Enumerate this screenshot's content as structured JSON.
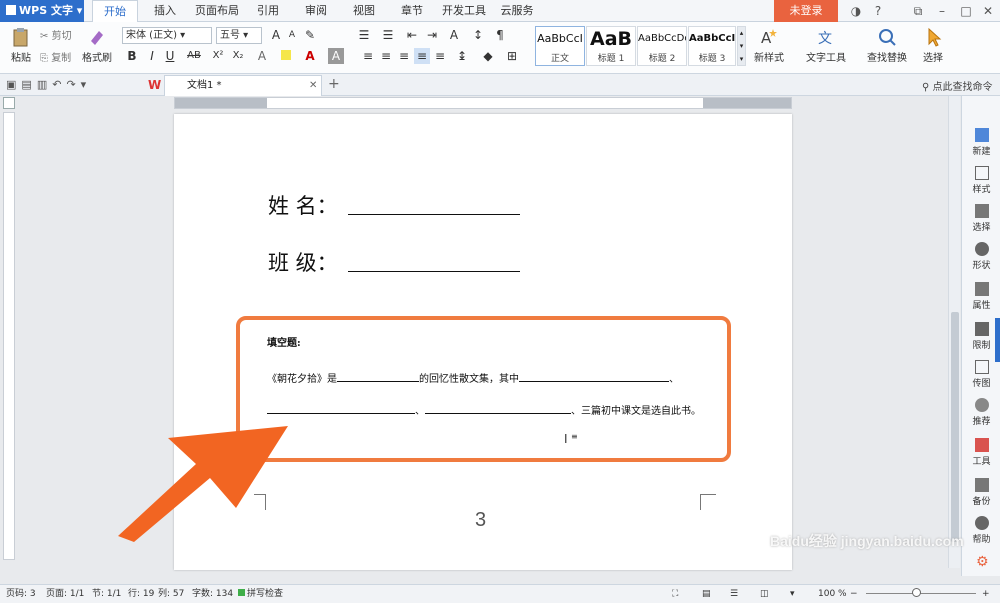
{
  "app": {
    "name": "WPS 文字",
    "login": "未登录"
  },
  "menu_tabs": [
    "开始",
    "插入",
    "页面布局",
    "引用",
    "审阅",
    "视图",
    "章节",
    "开发工具",
    "云服务"
  ],
  "ribbon": {
    "paste": "粘贴",
    "cut": "剪切",
    "copy": "复制",
    "format_painter": "格式刷",
    "font_name": "宋体 (正文)",
    "font_size": "五号",
    "styles": [
      {
        "sample": "AaBbCcI",
        "name": "正文"
      },
      {
        "sample": "AaB",
        "name": "标题 1"
      },
      {
        "sample": "AaBbCcDd",
        "name": "标题 2"
      },
      {
        "sample": "AaBbCcI",
        "name": "标题 3"
      }
    ],
    "new_style": "新样式",
    "text_tools": "文字工具",
    "find_replace": "查找替换",
    "select": "选择"
  },
  "doc_tab": {
    "title": "文档1 *"
  },
  "find_command": "点此查找命令",
  "document": {
    "name_label": "姓  名：",
    "class_label": "班  级：",
    "section_title": "填空题:",
    "line1_a": "《朝花夕拾》是",
    "line1_b": "的回忆性散文集，其中",
    "line1_c": "、",
    "line2_a": "、",
    "line2_b": "、三篇初中课文是选自此书。",
    "page_number": "3"
  },
  "side_panel": [
    "新建",
    "样式",
    "选择",
    "形状",
    "属性",
    "限制",
    "传图",
    "推荐",
    "工具",
    "备份",
    "帮助"
  ],
  "status": {
    "page": "页码: 3",
    "pages": "页面: 1/1",
    "section": "节: 1/1",
    "row": "行: 19",
    "col": "列: 57",
    "chars": "字数: 134",
    "spell": "拼写检查",
    "zoom": "100 %"
  },
  "watermark": "Baidu经验 jingyan.baidu.com",
  "colors": {
    "accent": "#2d6ecb",
    "callout": "#f07b3f",
    "arrow": "#f26522"
  }
}
